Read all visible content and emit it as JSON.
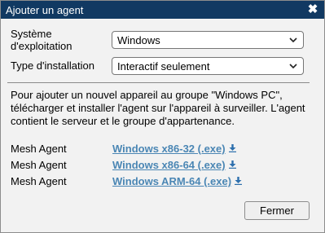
{
  "dialog": {
    "title": "Ajouter un agent",
    "close_glyph": "✖"
  },
  "form": {
    "os_label_line1": "Système",
    "os_label_line2": "d'exploitation",
    "os_value": "Windows",
    "install_label": "Type d'installation",
    "install_value": "Interactif seulement"
  },
  "description": "Pour ajouter un nouvel appareil au groupe \"Windows PC\", télécharger et installer l'agent sur l'appareil à surveiller. L'agent contient le serveur et le groupe d'appartenance.",
  "downloads": [
    {
      "label": "Mesh Agent",
      "link": "Windows x86-32 (.exe)",
      "icon": "download-icon"
    },
    {
      "label": "Mesh Agent",
      "link": "Windows x86-64 (.exe)",
      "icon": "download-icon"
    },
    {
      "label": "Mesh Agent",
      "link": "Windows ARM-64 (.exe)",
      "icon": "download-icon"
    }
  ],
  "footer": {
    "close_button": "Fermer"
  },
  "colors": {
    "titlebar": "#113962",
    "link": "#4a86b4"
  }
}
